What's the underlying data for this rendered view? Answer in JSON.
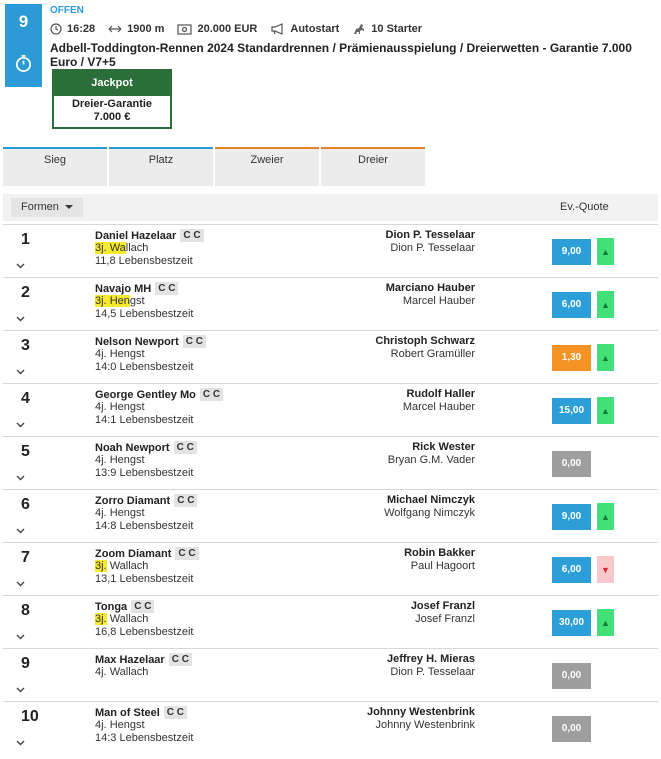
{
  "race": {
    "number": "9",
    "status": "OFFEN",
    "time": "16:28",
    "distance": "1900 m",
    "purse": "20.000 EUR",
    "start_type": "Autostart",
    "starters": "10 Starter",
    "title": "Adbell-Toddington-Rennen 2024 Standardrennen / Prämienausspielung / Dreierwetten - Garantie 7.000 Euro / V7+5"
  },
  "jackpot": {
    "label": "Jackpot",
    "text": "Dreier-Garantie 7.000 €"
  },
  "bet_tabs": [
    {
      "label": "Sieg",
      "color": "#2b9ad6"
    },
    {
      "label": "Platz",
      "color": "#2b9ad6"
    },
    {
      "label": "Zweier",
      "color": "#e5832a"
    },
    {
      "label": "Dreier",
      "color": "#e5832a"
    }
  ],
  "list_header": {
    "sort_label": "Formen",
    "odds_label": "Ev.-Quote"
  },
  "colors": {
    "accent": "#2b9ad6",
    "jackpot_green": "#2b6e3a",
    "odds_blue": "#2c9fd8",
    "odds_orange": "#f29324",
    "odds_grey": "#9e9e9e",
    "highlight": "#f5ea2d"
  },
  "runners": [
    {
      "nr": "1",
      "name": "Daniel Hazelaar",
      "tags": "C C",
      "age": "3j.",
      "highlight": "Wa",
      "rest": "llach",
      "best": "11,8 Lebensbestzeit",
      "driver": "Dion P. Tesselaar",
      "trainer": "Dion P. Tesselaar",
      "odds": "9,00",
      "odds_color": "blue",
      "trend": "up"
    },
    {
      "nr": "2",
      "name": "Navajo MH",
      "tags": "C C",
      "age": "3j.",
      "highlight": "Hen",
      "rest": "gst",
      "best": "14,5 Lebensbestzeit",
      "driver": "Marciano Hauber",
      "trainer": "Marcel Hauber",
      "odds": "6,00",
      "odds_color": "blue",
      "trend": "up"
    },
    {
      "nr": "3",
      "name": "Nelson Newport",
      "tags": "C C",
      "age": "4j.",
      "highlight": "",
      "rest": "Hengst",
      "best": "14:0 Lebensbestzeit",
      "driver": "Christoph Schwarz",
      "trainer": "Robert Gramüller",
      "odds": "1,30",
      "odds_color": "orange",
      "trend": "up"
    },
    {
      "nr": "4",
      "name": "George Gentley Mo",
      "tags": "C C",
      "age": "4j.",
      "highlight": "",
      "rest": "Hengst",
      "best": "14:1 Lebensbestzeit",
      "driver": "Rudolf Haller",
      "trainer": "Marcel Hauber",
      "odds": "15,00",
      "odds_color": "blue",
      "trend": "up"
    },
    {
      "nr": "5",
      "name": "Noah Newport",
      "tags": "C C",
      "age": "4j.",
      "highlight": "",
      "rest": "Hengst",
      "best": "13:9 Lebensbestzeit",
      "driver": "Rick Wester",
      "trainer": "Bryan G.M. Vader",
      "odds": "0,00",
      "odds_color": "grey",
      "trend": "none"
    },
    {
      "nr": "6",
      "name": "Zorro Diamant",
      "tags": "C C",
      "age": "4j.",
      "highlight": "",
      "rest": "Hengst",
      "best": "14:8 Lebensbestzeit",
      "driver": "Michael Nimczyk",
      "trainer": "Wolfgang Nimczyk",
      "odds": "9,00",
      "odds_color": "blue",
      "trend": "up"
    },
    {
      "nr": "7",
      "name": "Zoom Diamant",
      "tags": "C C",
      "age": "3j.",
      "highlight": "3j.",
      "rest": "Wallach",
      "best": "13,1 Lebensbestzeit",
      "driver": "Robin Bakker",
      "trainer": "Paul Hagoort",
      "odds": "6,00",
      "odds_color": "blue",
      "trend": "down"
    },
    {
      "nr": "8",
      "name": "Tonga",
      "tags": "C C",
      "age": "3j.",
      "highlight": "3j.",
      "rest": "Wallach",
      "best": "16,8 Lebensbestzeit",
      "driver": "Josef Franzl",
      "trainer": "Josef Franzl",
      "odds": "30,00",
      "odds_color": "blue",
      "trend": "up"
    },
    {
      "nr": "9",
      "name": "Max Hazelaar",
      "tags": "C C",
      "age": "4j.",
      "highlight": "",
      "rest": "Wallach",
      "best": "",
      "driver": "Jeffrey H. Mieras",
      "trainer": "Dion P. Tesselaar",
      "odds": "0,00",
      "odds_color": "grey",
      "trend": "none"
    },
    {
      "nr": "10",
      "name": "Man of Steel",
      "tags": "C C",
      "age": "4j.",
      "highlight": "",
      "rest": "Hengst",
      "best": "14:3 Lebensbestzeit",
      "driver": "Johnny Westenbrink",
      "trainer": "Johnny Westenbrink",
      "odds": "0,00",
      "odds_color": "grey",
      "trend": "none"
    }
  ]
}
